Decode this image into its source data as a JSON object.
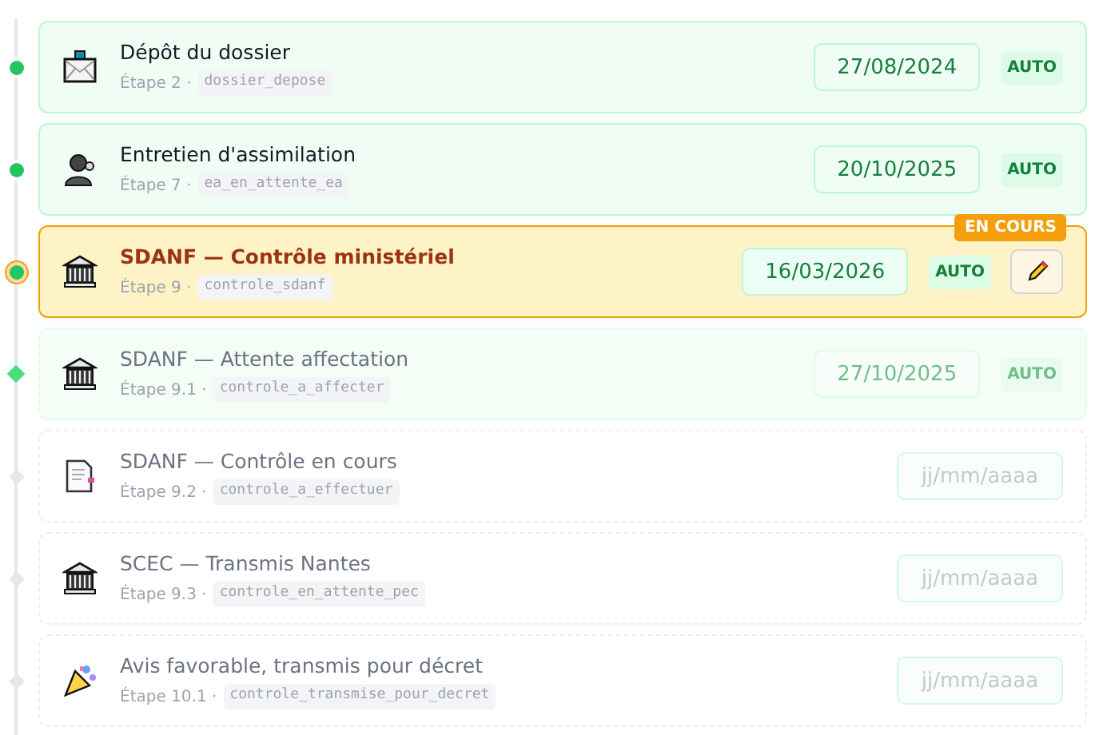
{
  "steps": [
    {
      "title": "Dépôt du dossier",
      "step": "Étape 2 ·",
      "code": "dossier_depose",
      "kind": "done",
      "date": "27/08/2024",
      "auto": "AUTO"
    },
    {
      "title": "Entretien d'assimilation",
      "step": "Étape 7 ·",
      "code": "ea_en_attente_ea",
      "kind": "done",
      "date": "20/10/2025",
      "auto": "AUTO"
    },
    {
      "title": "SDANF — Contrôle ministériel",
      "step": "Étape 9 ·",
      "code": "controle_sdanf",
      "kind": "current",
      "date": "16/03/2026",
      "auto": "AUTO",
      "badge": "EN COURS",
      "editable": true
    },
    {
      "title": "SDANF — Attente affectation",
      "step": "Étape 9.1 ·",
      "code": "controle_a_affecter",
      "kind": "estimated",
      "date": "27/10/2025",
      "auto": "AUTO"
    },
    {
      "title": "SDANF — Contrôle en cours",
      "step": "Étape 9.2 ·",
      "code": "controle_a_effectuer",
      "kind": "pending",
      "placeholder": "jj/mm/aaaa"
    },
    {
      "title": "SCEC — Transmis Nantes",
      "step": "Étape 9.3 ·",
      "code": "controle_en_attente_pec",
      "kind": "pending",
      "placeholder": "jj/mm/aaaa"
    },
    {
      "title": "Avis favorable, transmis pour décret",
      "step": "Étape 10.1 ·",
      "code": "controle_transmise_pour_decret",
      "kind": "pending",
      "placeholder": "jj/mm/aaaa"
    }
  ]
}
